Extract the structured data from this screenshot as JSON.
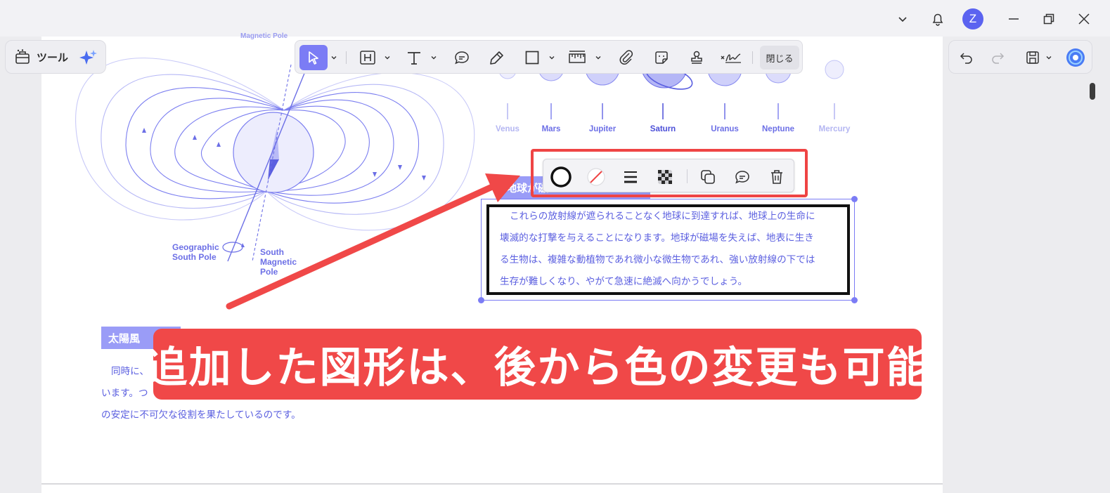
{
  "titlebar": {
    "avatar_initial": "Z",
    "icons": [
      "chevron-down-icon",
      "bell-icon",
      "minimize-icon",
      "restore-icon",
      "close-icon"
    ]
  },
  "tool_panel": {
    "tools_label": "ツール",
    "ai_icon": "sparkle-icon"
  },
  "main_toolbar": {
    "tools": [
      "select-icon",
      "heading-icon",
      "text-icon",
      "comment-icon",
      "pen-icon",
      "rectangle-icon",
      "measure-icon",
      "attachment-icon",
      "sticker-icon",
      "stamp-icon",
      "signature-icon"
    ],
    "close_label": "閉じる"
  },
  "shape_toolbar": {
    "tools": [
      "stroke-color-icon",
      "fill-color-icon",
      "line-width-icon",
      "opacity-icon",
      "duplicate-icon",
      "comment-icon",
      "delete-icon"
    ]
  },
  "right_panel": {
    "tools": [
      "undo-icon",
      "redo-icon",
      "save-icon",
      "chevron-down-icon",
      "ai-assistant-icon"
    ]
  },
  "figure_magnet": {
    "top_label": "Magnetic Pole",
    "geo_south_label_1": "Geographic",
    "geo_south_label_2": "South Pole",
    "south_mag_label_1": "South",
    "south_mag_label_2": "Magnetic",
    "south_mag_label_3": "Pole"
  },
  "figure_planets": {
    "planets": [
      "Venus",
      "Mars",
      "Jupiter",
      "Saturn",
      "Uranus",
      "Neptune",
      "Mercury"
    ]
  },
  "document": {
    "section1_tag": "地球が磁",
    "selected_paragraph": [
      "これらの放射線が遮られることなく地球に到達すれば、地球上の生命に",
      "壊滅的な打撃を与えることになります。地球が磁場を失えば、地表に生き",
      "る生物は、複雑な動植物であれ微小な微生物であれ、強い放射線の下では",
      "生存が難しくなり、やがて急速に絶滅へ向かうでしょう。"
    ],
    "section2_tag": "太陽風",
    "paragraph2": [
      "同時に、",
      "います。つ",
      "の安定に不可欠な役割を果たしているのです。"
    ]
  },
  "banner": {
    "text": "追加した図形は、後から色の変更も可能"
  },
  "colors": {
    "accent": "#7b7cf5",
    "banner": "#f04848",
    "highlight": "#ef4444",
    "text_blue": "#5c60e0"
  }
}
